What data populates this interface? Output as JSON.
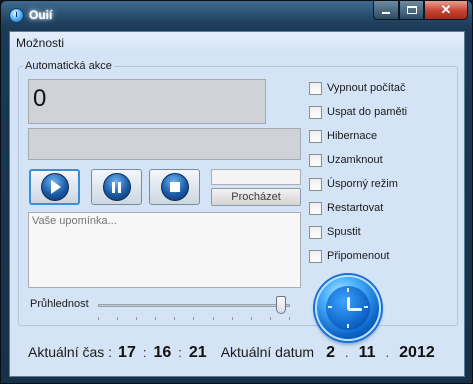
{
  "window": {
    "title": "Ouií",
    "icon": "clock-app-icon"
  },
  "menu": {
    "options_label": "Možnosti"
  },
  "group": {
    "title": "Automatická akce"
  },
  "display": {
    "counter": "0"
  },
  "media": {
    "play_icon": "play-icon",
    "pause_icon": "pause-icon",
    "stop_icon": "stop-icon"
  },
  "path": {
    "value": "",
    "browse_label": "Procházet"
  },
  "reminder": {
    "placeholder": "Vaše upomínka..."
  },
  "opacity": {
    "label": "Průhlednost",
    "level": 0.98
  },
  "actions": [
    {
      "label": "Vypnout počítač",
      "checked": false
    },
    {
      "label": "Uspat do paměti",
      "checked": false
    },
    {
      "label": "Hibernace",
      "checked": false
    },
    {
      "label": "Uzamknout",
      "checked": false
    },
    {
      "label": "Úsporný režim",
      "checked": false
    },
    {
      "label": "Restartovat",
      "checked": false
    },
    {
      "label": "Spustit",
      "checked": false
    },
    {
      "label": "Připomenout",
      "checked": false
    }
  ],
  "status": {
    "time_label": "Aktuální čas :",
    "hours": "17",
    "minutes": "16",
    "seconds": "21",
    "time_sep": ":",
    "date_label": "Aktuální datum",
    "day": "2",
    "month": "11",
    "year": "2012",
    "date_sep": "."
  },
  "colors": {
    "client_bg": "#d4e4f6",
    "accent_blue": "#0c63c6",
    "close_red": "#c5432f"
  }
}
